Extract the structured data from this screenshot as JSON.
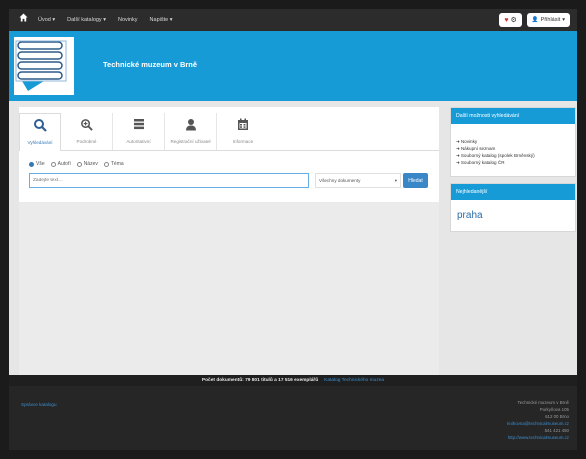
{
  "navbar": {
    "menu": [
      "Úvod",
      "Další katalogy",
      "Novinky",
      "Napište"
    ],
    "login_label": "Přihlásit"
  },
  "header": {
    "site_title": "Technické muzeum v Brně"
  },
  "tabs": [
    {
      "label": "Vyhledávání",
      "icon": "search-icon"
    },
    {
      "label": "Podrobné",
      "icon": "zoom-in-icon"
    },
    {
      "label": "Autoritativní",
      "icon": "list-icon"
    },
    {
      "label": "Registrační uživatel",
      "icon": "user-icon"
    },
    {
      "label": "Informace",
      "icon": "calendar-icon"
    }
  ],
  "search": {
    "radios": [
      "Vše",
      "Autoři",
      "Název",
      "Téma"
    ],
    "selected": "Vše",
    "placeholder": "Zadejte text…",
    "select_value": "Všechny dokumenty",
    "button_label": "Hledat"
  },
  "side": {
    "resources_title": "Další možnosti vyhledávání",
    "resources": [
      "Novinky",
      "Nákupní seznam",
      "Souborný katalog (spolek Brněnský)",
      "Souborný katalog ČR"
    ],
    "popular_title": "Nejhledanější",
    "popular_tag": "praha"
  },
  "footer": {
    "bar_text": "Počet dokumentů: 79 801 titulů a 17 516 exemplářů",
    "bar_link": "Katalog Technického muzea",
    "left_link": "Správce katalogu",
    "address": [
      "Technické muzeum v Brně",
      "Purkyňova 105",
      "612 00 Brno",
      "knihovna@technicalmuseum.cz",
      "541 421 450",
      "http://www.technicalmuseum.cz"
    ]
  },
  "colors": {
    "brand_blue": "#179bd7",
    "navbar_dark": "#2c2c2c",
    "button_blue": "#3a87c8"
  }
}
